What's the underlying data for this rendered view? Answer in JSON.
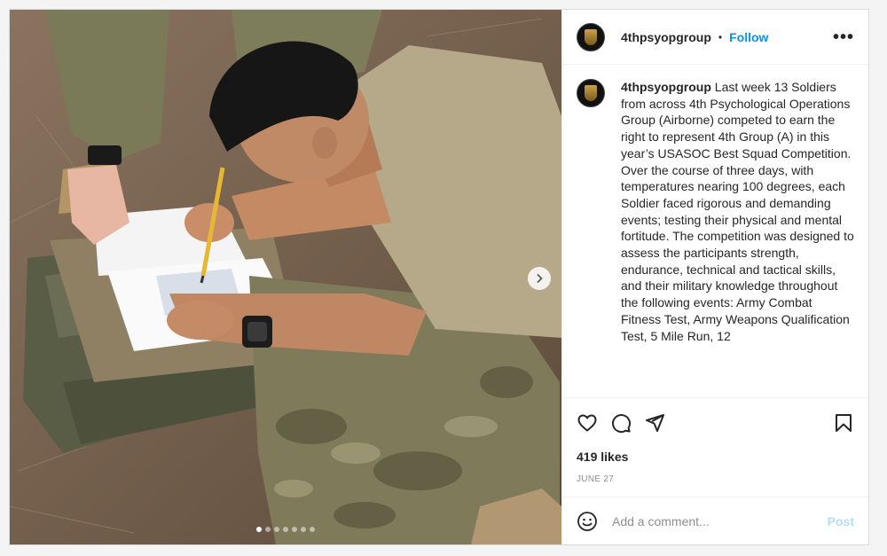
{
  "post": {
    "username": "4thpsyopgroup",
    "separator": "•",
    "follow_label": "Follow",
    "more_label": "•••",
    "caption": "Last week 13 Soldiers from across 4th Psychological Operations Group (Airborne) competed to earn the right to represent 4th Group (A) in this year’s USASOC Best Squad Competition. Over the course of three days, with temperatures nearing 100 degrees, each Soldier faced rigorous and demanding events; testing their physical and mental fortitude. The competition was designed to assess the participants strength, endurance, technical and tactical skills, and their military knowledge throughout the following events: Army Combat Fitness Test, Army Weapons Qualification Test, 5 Mile Run, 12",
    "likes": "419 likes",
    "date": "June 27",
    "comment_placeholder": "Add a comment...",
    "post_label": "Post"
  },
  "carousel": {
    "total_slides": 7,
    "active_slide": 1
  },
  "icons": {
    "like": "heart-icon",
    "comment": "comment-icon",
    "share": "paper-plane-icon",
    "save": "bookmark-icon",
    "emoji": "smiley-icon",
    "next": "chevron-right-icon"
  },
  "colors": {
    "follow": "#0095f6",
    "post_disabled": "#b2dffc",
    "muted": "#8e8e8e"
  }
}
